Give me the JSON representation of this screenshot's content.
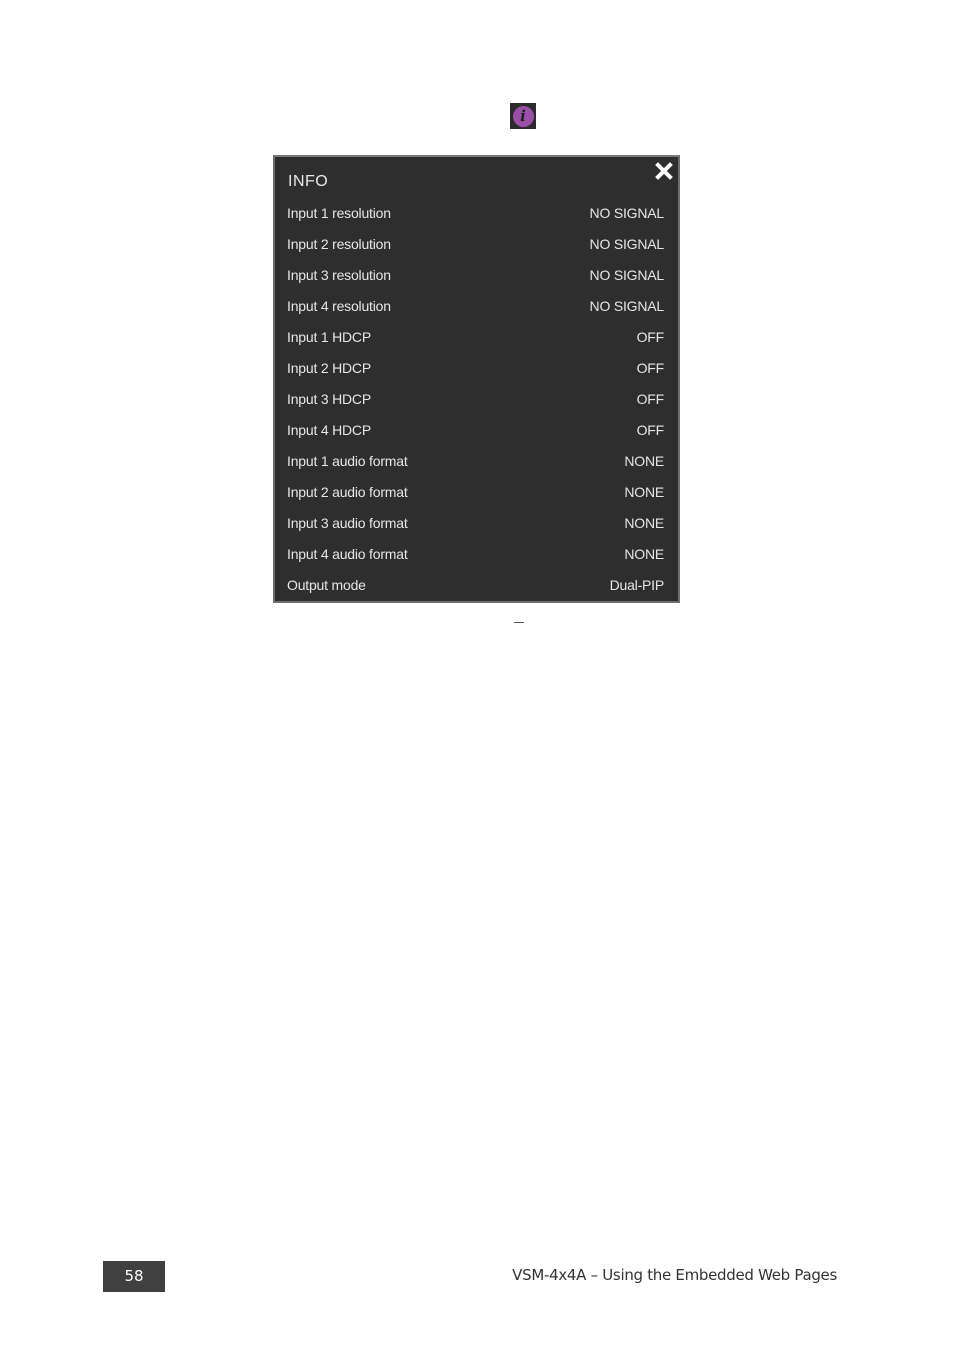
{
  "info_button": {
    "icon": "info-icon",
    "glyph": "i",
    "color": "#9a4fa8"
  },
  "info_panel": {
    "title": "INFO",
    "close_icon": "close-icon",
    "rows": [
      {
        "label": "Input 1 resolution",
        "value": "NO SIGNAL"
      },
      {
        "label": "Input 2 resolution",
        "value": "NO SIGNAL"
      },
      {
        "label": "Input 3 resolution",
        "value": "NO SIGNAL"
      },
      {
        "label": "Input 4 resolution",
        "value": "NO SIGNAL"
      },
      {
        "label": "Input 1 HDCP",
        "value": "OFF"
      },
      {
        "label": "Input 2 HDCP",
        "value": "OFF"
      },
      {
        "label": "Input 3 HDCP",
        "value": "OFF"
      },
      {
        "label": "Input 4 HDCP",
        "value": "OFF"
      },
      {
        "label": "Input 1 audio format",
        "value": "NONE"
      },
      {
        "label": "Input 2 audio format",
        "value": "NONE"
      },
      {
        "label": "Input 3 audio format",
        "value": "NONE"
      },
      {
        "label": "Input 4 audio format",
        "value": "NONE"
      },
      {
        "label": "Output mode",
        "value": "Dual-PIP"
      }
    ]
  },
  "caption_dash": "–",
  "footer": {
    "page_number": "58",
    "title": "VSM-4x4A – Using the Embedded Web Pages"
  }
}
